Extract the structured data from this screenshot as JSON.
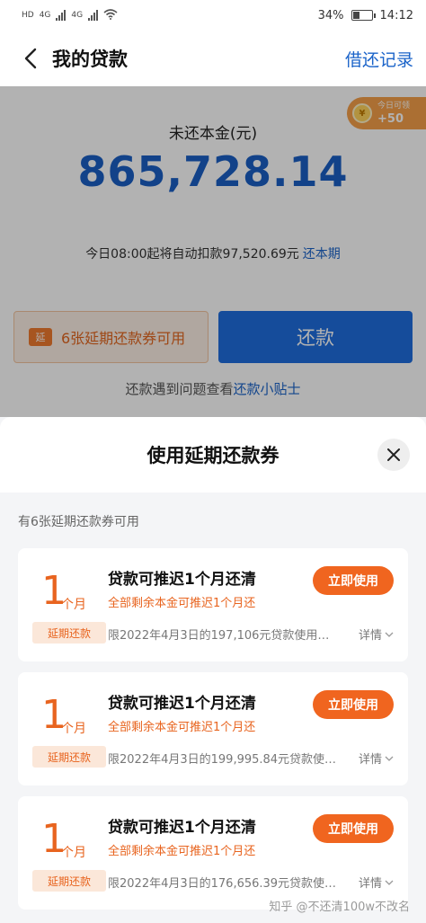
{
  "status_bar": {
    "network_left": "HD",
    "network_4g_1": "4G",
    "network_4g_2": "4G",
    "battery": "34%",
    "time": "14:12"
  },
  "header": {
    "title": "我的贷款",
    "history_link": "借还记录"
  },
  "summary": {
    "principal_label": "未还本金(元)",
    "principal_amount": "865,728.14",
    "auto_debit_text": "今日08:00起将自动扣款97,520.69元",
    "auto_debit_link": "还本期"
  },
  "reward_badge": {
    "label": "今日可领",
    "value": "+50"
  },
  "actions": {
    "coupon_icon": "延",
    "coupon_label": "6张延期还款券可用",
    "repay_label": "还款"
  },
  "tips": {
    "text": "还款遇到问题查看",
    "link": "还款小贴士"
  },
  "sheet": {
    "title": "使用延期还款券",
    "available_text": "有6张延期还款券可用"
  },
  "coupons": [
    {
      "number": "1",
      "unit": "个月",
      "tag": "延期还款",
      "title": "贷款可推迟1个月还清",
      "subtitle": "全部剩余本金可推迟1个月还",
      "button": "立即使用",
      "desc": "限2022年4月3日的197,106元贷款使用…",
      "detail": "详情"
    },
    {
      "number": "1",
      "unit": "个月",
      "tag": "延期还款",
      "title": "贷款可推迟1个月还清",
      "subtitle": "全部剩余本金可推迟1个月还",
      "button": "立即使用",
      "desc": "限2022年4月3日的199,995.84元贷款使…",
      "detail": "详情"
    },
    {
      "number": "1",
      "unit": "个月",
      "tag": "延期还款",
      "title": "贷款可推迟1个月还清",
      "subtitle": "全部剩余本金可推迟1个月还",
      "button": "立即使用",
      "desc": "限2022年4月3日的176,656.39元贷款使…",
      "detail": "详情"
    }
  ],
  "watermark": "知乎 @不还清100w不改名",
  "colors": {
    "primary_blue": "#1f6dde",
    "amount_blue": "#1a5fc4",
    "accent_orange": "#f0651f",
    "tag_bg": "#fbe7d9"
  }
}
